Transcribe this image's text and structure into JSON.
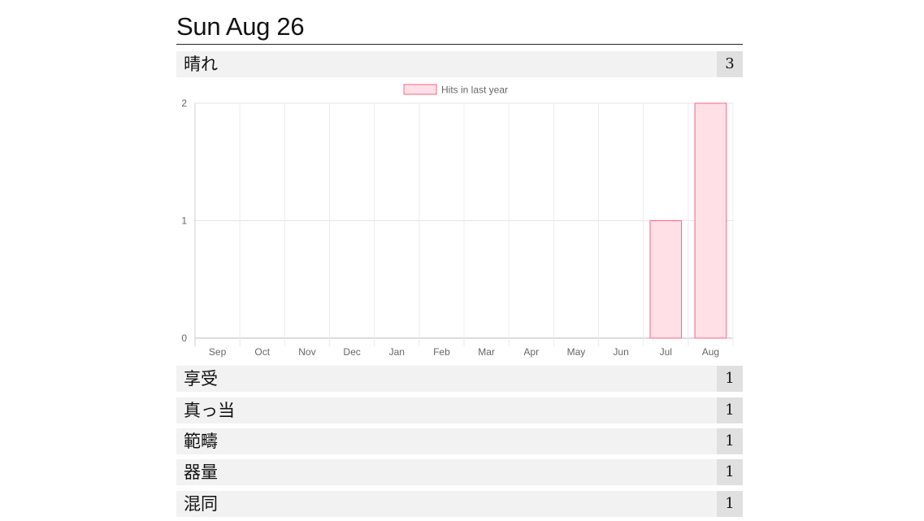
{
  "page": {
    "title": "Sun Aug 26"
  },
  "top_entry": {
    "word": "晴れ",
    "count": "3"
  },
  "entries": [
    {
      "word": "享受",
      "count": "1"
    },
    {
      "word": "真っ当",
      "count": "1"
    },
    {
      "word": "範疇",
      "count": "1"
    },
    {
      "word": "器量",
      "count": "1"
    },
    {
      "word": "混同",
      "count": "1"
    }
  ],
  "chart_data": {
    "type": "bar",
    "categories": [
      "Sep",
      "Oct",
      "Nov",
      "Dec",
      "Jan",
      "Feb",
      "Mar",
      "Apr",
      "May",
      "Jun",
      "Jul",
      "Aug"
    ],
    "series": [
      {
        "name": "Hits in last year",
        "values": [
          0,
          0,
          0,
          0,
          0,
          0,
          0,
          0,
          0,
          0,
          1,
          2
        ],
        "color": "#ff6384",
        "fill": "#ffe0e6"
      }
    ],
    "ylim": [
      0,
      2
    ],
    "yticks": [
      "0",
      "1",
      "2"
    ],
    "grid": true,
    "legend": "top-center"
  }
}
